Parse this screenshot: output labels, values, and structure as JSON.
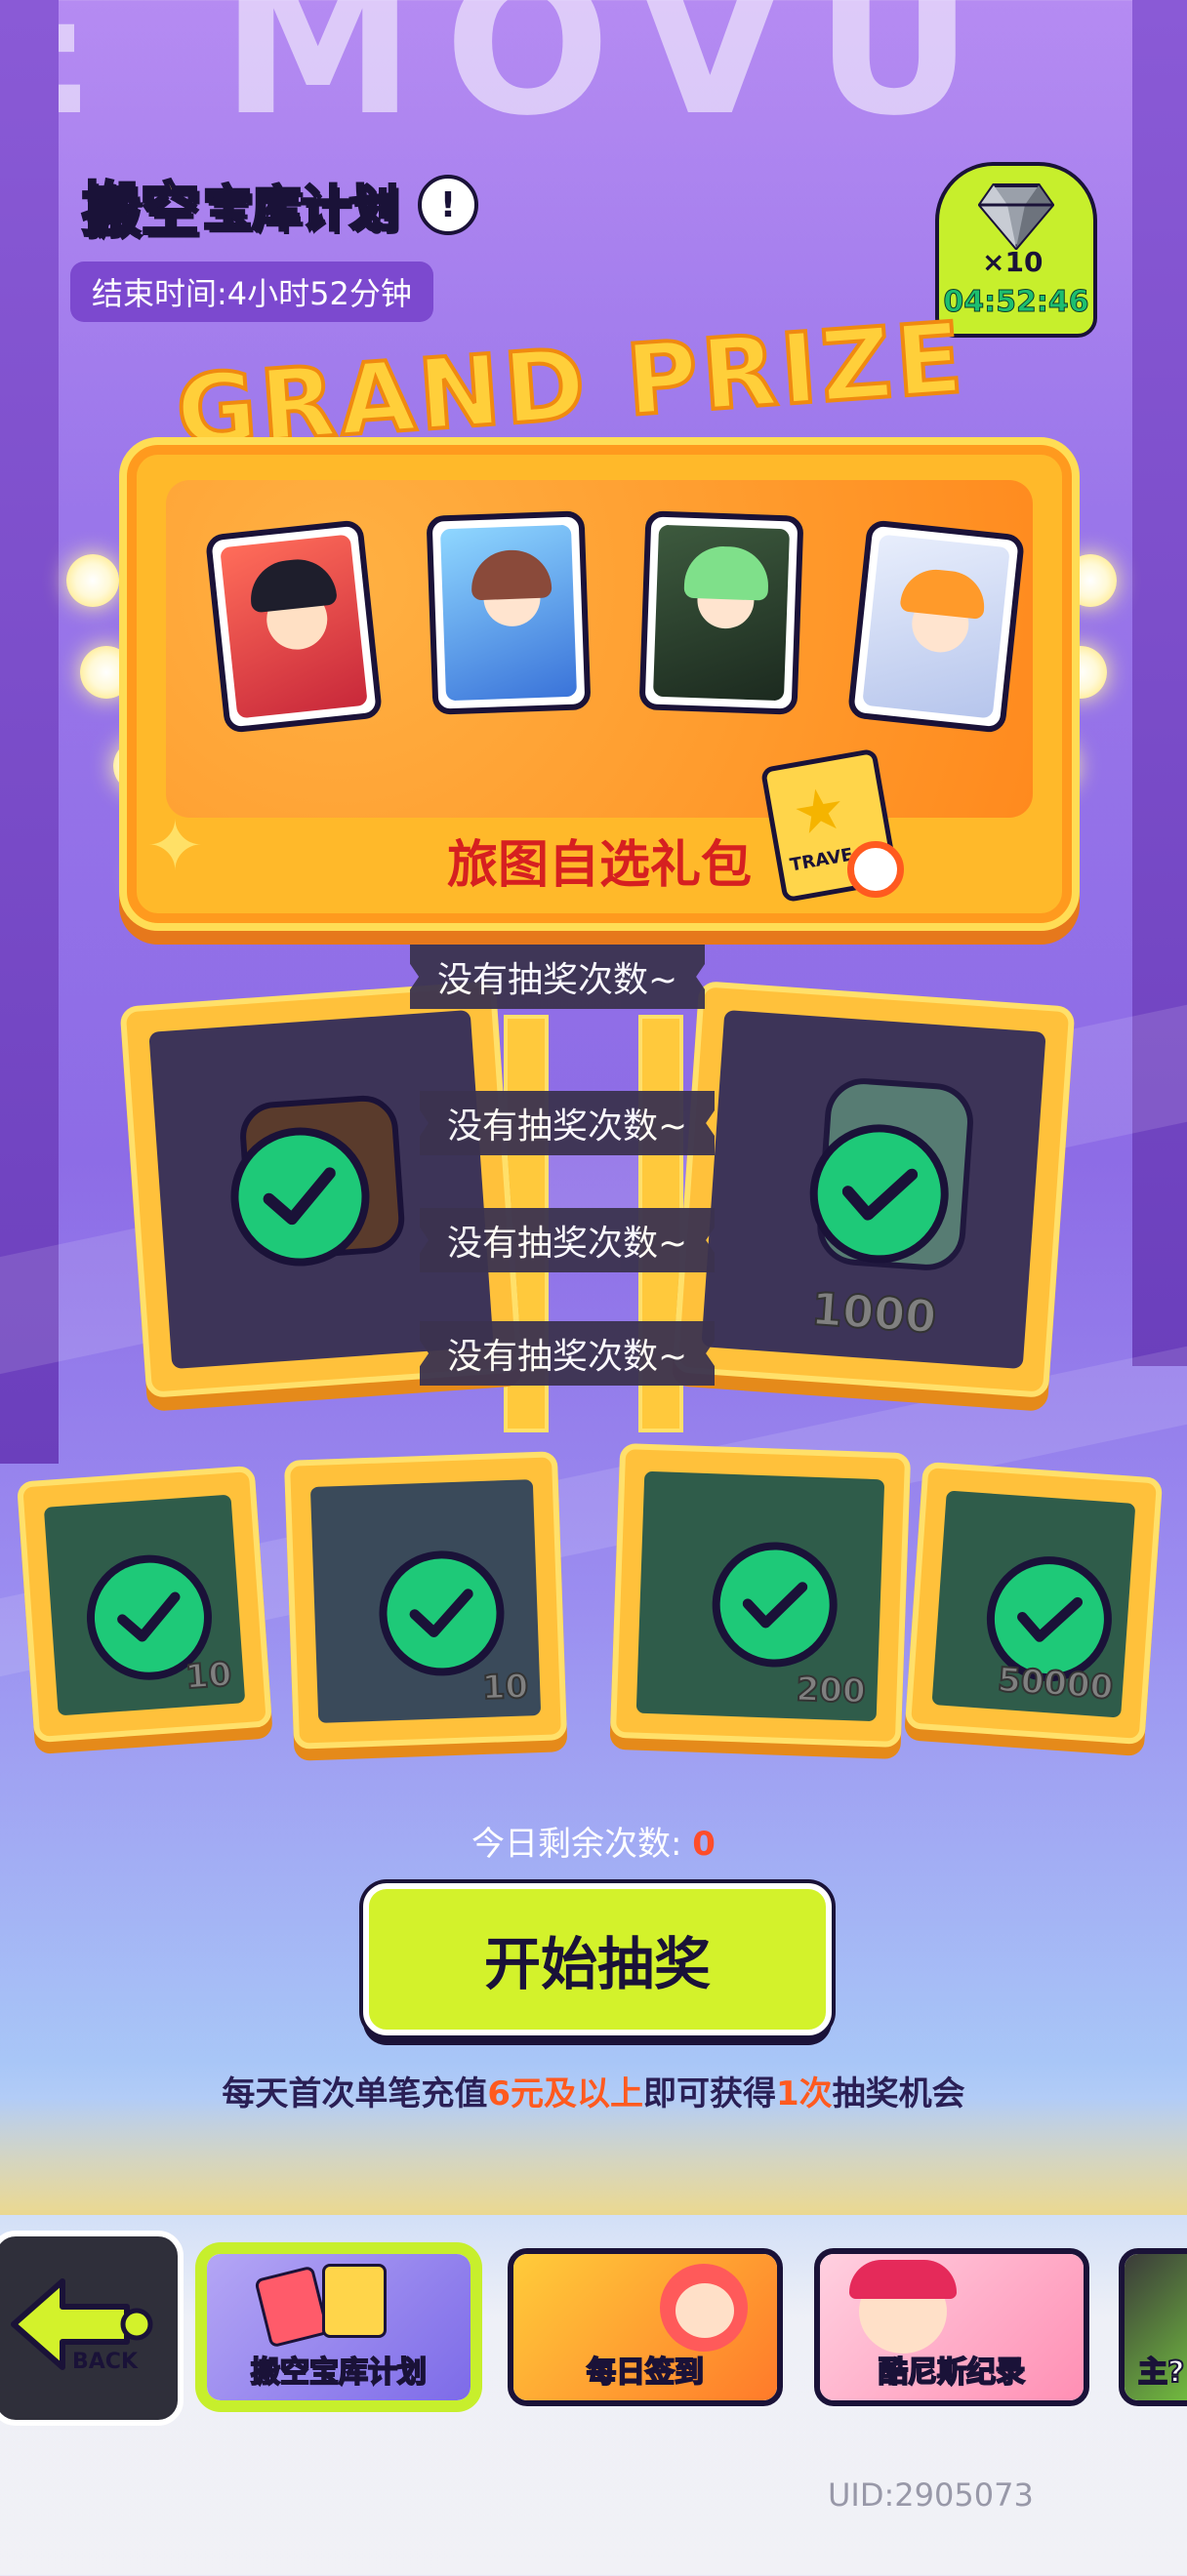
{
  "header": {
    "title_highlight": "搬空",
    "title_rest": "宝库计划",
    "info_icon": "!",
    "end_time": "结束时间:4小时52分钟"
  },
  "gem_badge": {
    "icon": "diamond-icon",
    "count": "×10",
    "timer": "04:52:46"
  },
  "grand_prize": {
    "title": "GRAND PRIZE",
    "label": "旅图自选礼包",
    "pack_text": "TRAVE"
  },
  "tags": [
    "没有抽奖次数~",
    "没有抽奖次数~",
    "没有抽奖次数~",
    "没有抽奖次数~"
  ],
  "mid_prizes": [
    {
      "value": "",
      "claimed": true
    },
    {
      "value": "1000",
      "claimed": true
    }
  ],
  "small_prizes": [
    {
      "value": "10",
      "claimed": true
    },
    {
      "value": "10",
      "claimed": true
    },
    {
      "value": "200",
      "claimed": true
    },
    {
      "value": "50000",
      "claimed": true
    }
  ],
  "remaining": {
    "label": "今日剩余次数:",
    "count": "0"
  },
  "start_button": "开始抽奖",
  "promo": {
    "p1": "每天首次单笔充值",
    "h1": "6元及以上",
    "p2": "即可获得",
    "h2": "1次",
    "p3": "抽奖机会"
  },
  "nav": {
    "back_label": "BACK",
    "items": [
      "搬空宝库计划",
      "每日签到",
      "酷尼斯纪录",
      "主?"
    ]
  },
  "uid": "UID:2905073"
}
